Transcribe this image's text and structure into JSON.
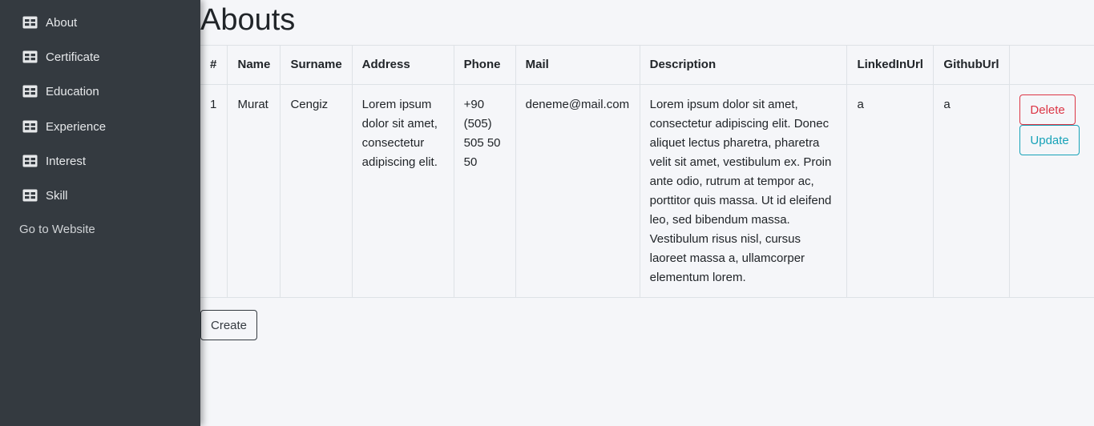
{
  "sidebar": {
    "items": [
      {
        "label": "About",
        "icon": "table-icon"
      },
      {
        "label": "Certificate",
        "icon": "table-icon"
      },
      {
        "label": "Education",
        "icon": "table-icon"
      },
      {
        "label": "Experience",
        "icon": "table-icon"
      },
      {
        "label": "Interest",
        "icon": "table-icon"
      },
      {
        "label": "Skill",
        "icon": "table-icon"
      }
    ],
    "goto_label": "Go to Website"
  },
  "page": {
    "title": "Abouts"
  },
  "table": {
    "headers": [
      "#",
      "Name",
      "Surname",
      "Address",
      "Phone",
      "Mail",
      "Description",
      "LinkedInUrl",
      "GithubUrl",
      ""
    ],
    "rows": [
      {
        "id": "1",
        "name": "Murat",
        "surname": "Cengiz",
        "address": "Lorem ipsum dolor sit amet, consectetur adipiscing elit.",
        "phone": "+90 (505) 505 50 50",
        "mail": "deneme@mail.com",
        "description": "Lorem ipsum dolor sit amet, consectetur adipiscing elit. Donec aliquet lectus pharetra, pharetra velit sit amet, vestibulum ex. Proin ante odio, rutrum at tempor ac, porttitor quis massa. Ut id eleifend leo, sed bibendum massa. Vestibulum risus nisl, cursus laoreet massa a, ullamcorper elementum lorem.",
        "linkedin": "a",
        "github": "a",
        "delete_label": "Delete",
        "update_label": "Update"
      }
    ]
  },
  "actions": {
    "create_label": "Create"
  },
  "colors": {
    "sidebar_bg": "#343a40",
    "danger": "#dc3545",
    "info": "#17a2b8",
    "dark": "#343a40"
  }
}
